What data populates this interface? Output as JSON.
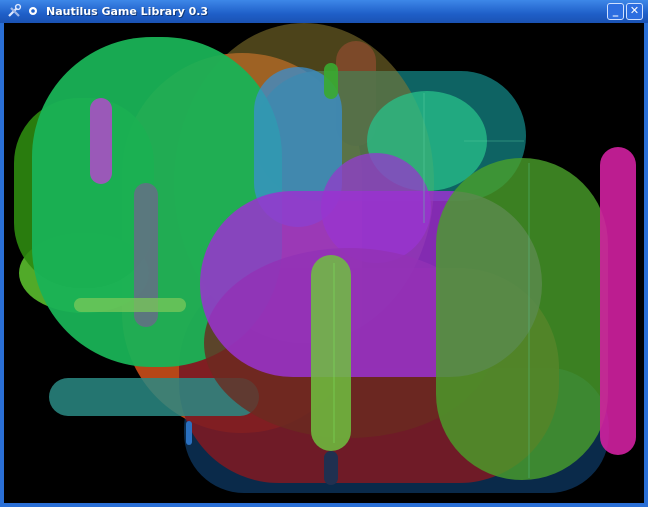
{
  "window": {
    "title": "Nautilus Game Library 0.3",
    "app_icon": "wrench-screwdriver-icon",
    "menu_icon": "window-menu-icon",
    "minimize_label": "_",
    "close_label": "✕"
  },
  "scene": {
    "background": "#000000",
    "shapes": [
      {
        "name": "navy-capsule",
        "color": "#0a2a4a",
        "opacity": 1.0
      },
      {
        "name": "orange-capsule",
        "color": "#c04a18",
        "opacity": 0.95
      },
      {
        "name": "lime-capsule",
        "color": "#5fc830",
        "opacity": 0.85
      },
      {
        "name": "dark-green-capsule",
        "color": "#2e8a10",
        "opacity": 0.9
      },
      {
        "name": "maroon-capsule",
        "color": "#7a1a24",
        "opacity": 0.9
      },
      {
        "name": "teal-bar",
        "color": "#2a8a84",
        "opacity": 0.85
      },
      {
        "name": "dark-teal-capsule",
        "color": "#0f6e6e",
        "opacity": 0.9
      },
      {
        "name": "green-capsule-large",
        "color": "#19b256",
        "opacity": 0.95
      },
      {
        "name": "blue-capsule",
        "color": "#3a8fd0",
        "opacity": 0.75
      },
      {
        "name": "olive-ellipse",
        "color": "#8a7a30",
        "opacity": 0.55
      },
      {
        "name": "teal-green-ellipse",
        "color": "#28c08a",
        "opacity": 0.75
      },
      {
        "name": "purple-circle",
        "color": "#8e3ec8",
        "opacity": 0.8
      },
      {
        "name": "brown-ellipse",
        "color": "#6a2a20",
        "opacity": 0.8
      },
      {
        "name": "purple-capsule",
        "color": "#9a32d0",
        "opacity": 0.85
      },
      {
        "name": "green-capsule-right",
        "color": "#4aa02a",
        "opacity": 0.8
      },
      {
        "name": "magenta-bar",
        "color": "#d020a0",
        "opacity": 0.9
      },
      {
        "name": "violet-bar",
        "color": "#b24aca",
        "opacity": 0.85
      },
      {
        "name": "gray-bar",
        "color": "#6a6a8a",
        "opacity": 0.8
      },
      {
        "name": "light-green-bar",
        "color": "#7ac85a",
        "opacity": 0.75
      },
      {
        "name": "faint-line",
        "color": "#5ad0a0",
        "opacity": 0.5
      }
    ]
  }
}
